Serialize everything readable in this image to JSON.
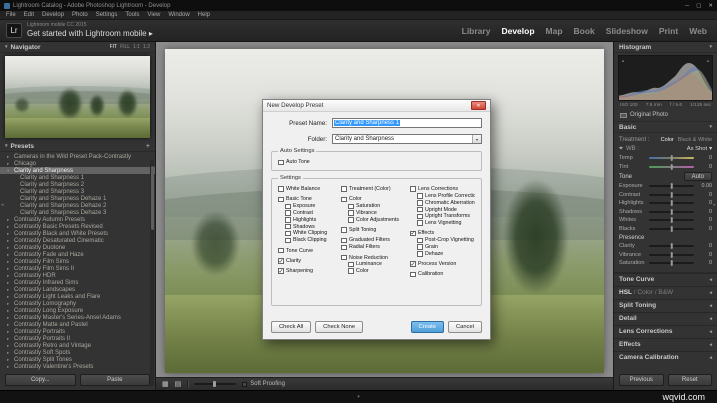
{
  "window": {
    "title": "Lightroom Catalog - Adobe Photoshop Lightroom - Develop"
  },
  "menubar": {
    "items": [
      "File",
      "Edit",
      "Develop",
      "Photo",
      "Settings",
      "Tools",
      "View",
      "Window",
      "Help"
    ]
  },
  "header": {
    "logo": "Lr",
    "identity_small": "Lightroom mobile CC 2015",
    "identity_large": "Get started with Lightroom mobile ▸",
    "modules": [
      {
        "label": "Library",
        "active": false
      },
      {
        "label": "Develop",
        "active": true
      },
      {
        "label": "Map",
        "active": false
      },
      {
        "label": "Book",
        "active": false
      },
      {
        "label": "Slideshow",
        "active": false
      },
      {
        "label": "Print",
        "active": false
      },
      {
        "label": "Web",
        "active": false
      }
    ]
  },
  "navigator": {
    "title": "Navigator",
    "zoom_options": [
      "FIT",
      "FILL",
      "1:1",
      "1:2"
    ]
  },
  "presets": {
    "title": "Presets",
    "add_label": "+",
    "items": [
      {
        "label": "Cameras in the Wild Preset Pack-Contrastly",
        "type": "folder"
      },
      {
        "label": "Chicago",
        "type": "folder"
      },
      {
        "label": "Clarity and Sharpness",
        "type": "folder",
        "expanded": true,
        "active": true
      },
      {
        "label": "Clarity and Sharpness 1",
        "type": "preset"
      },
      {
        "label": "Clarity and Sharpness 2",
        "type": "preset"
      },
      {
        "label": "Clarity and Sharpness 3",
        "type": "preset"
      },
      {
        "label": "Clarity and Sharpness Dehaze 1",
        "type": "preset"
      },
      {
        "label": "Clarity and Sharpness Dehaze 2",
        "type": "preset"
      },
      {
        "label": "Clarity and Sharpness Dehaze 3",
        "type": "preset"
      },
      {
        "label": "Contrastly Autumn Presets",
        "type": "folder"
      },
      {
        "label": "Contrastly Basic Presets Revised",
        "type": "folder"
      },
      {
        "label": "Contrastly Black and White Presets",
        "type": "folder"
      },
      {
        "label": "Contrastly Desaturated Cinematic",
        "type": "folder"
      },
      {
        "label": "Contrastly Duotone",
        "type": "folder"
      },
      {
        "label": "Contrastly Fade and Haze",
        "type": "folder"
      },
      {
        "label": "Contrastly Film Sims",
        "type": "folder"
      },
      {
        "label": "Contrastly Film Sims II",
        "type": "folder"
      },
      {
        "label": "Contrastly HDR",
        "type": "folder"
      },
      {
        "label": "Contrastly Infrared Sims",
        "type": "folder"
      },
      {
        "label": "Contrastly Landscapes",
        "type": "folder"
      },
      {
        "label": "Contrastly Light Leaks and Flare",
        "type": "folder"
      },
      {
        "label": "Contrastly Lomography",
        "type": "folder"
      },
      {
        "label": "Contrastly Long Exposure",
        "type": "folder"
      },
      {
        "label": "Contrastly Master's Series-Ansel Adams",
        "type": "folder"
      },
      {
        "label": "Contrastly Matte and Pastel",
        "type": "folder"
      },
      {
        "label": "Contrastly Portraits",
        "type": "folder"
      },
      {
        "label": "Contrastly Portraits II",
        "type": "folder"
      },
      {
        "label": "Contrastly Retro and Vintage",
        "type": "folder"
      },
      {
        "label": "Contrastly Soft Spots",
        "type": "folder"
      },
      {
        "label": "Contrastly Split Tones",
        "type": "folder"
      },
      {
        "label": "Contrastly Valentine's Presets",
        "type": "folder"
      }
    ]
  },
  "left_buttons": {
    "copy": "Copy...",
    "paste": "Paste"
  },
  "toolbar": {
    "soft_proofing": "Soft Proofing"
  },
  "dialog": {
    "title": "New Develop Preset",
    "preset_name_label": "Preset Name:",
    "preset_name_value": "Clarity and Sharpness 1",
    "folder_label": "Folder:",
    "folder_value": "Clarity and Sharpness",
    "auto_group_label": "Auto Settings",
    "auto_tone": {
      "label": "Auto Tone",
      "checked": false
    },
    "settings_group_label": "Settings",
    "columns": [
      [
        {
          "label": "White Balance",
          "checked": false
        },
        {
          "label": "Basic Tone",
          "checked": false,
          "gap": true
        },
        {
          "label": "Exposure",
          "checked": false,
          "sub": true
        },
        {
          "label": "Contrast",
          "checked": false,
          "sub": true
        },
        {
          "label": "Highlights",
          "checked": false,
          "sub": true
        },
        {
          "label": "Shadows",
          "checked": false,
          "sub": true
        },
        {
          "label": "White Clipping",
          "checked": false,
          "sub": true
        },
        {
          "label": "Black Clipping",
          "checked": false,
          "sub": true
        },
        {
          "label": "Tone Curve",
          "checked": false,
          "gap": true
        },
        {
          "label": "Clarity",
          "checked": true,
          "gap": true
        },
        {
          "label": "Sharpening",
          "checked": true,
          "gap": true
        }
      ],
      [
        {
          "label": "Treatment (Color)",
          "checked": false
        },
        {
          "label": "Color",
          "checked": false,
          "gap": true
        },
        {
          "label": "Saturation",
          "checked": false,
          "sub": true
        },
        {
          "label": "Vibrance",
          "checked": false,
          "sub": true
        },
        {
          "label": "Color Adjustments",
          "checked": false,
          "sub": true
        },
        {
          "label": "Split Toning",
          "checked": false,
          "gap": true
        },
        {
          "label": "Graduated Filters",
          "checked": false,
          "gap": true
        },
        {
          "label": "Radial Filters",
          "checked": false
        },
        {
          "label": "Noise Reduction",
          "checked": false,
          "gap": true
        },
        {
          "label": "Luminance",
          "checked": false,
          "sub": true
        },
        {
          "label": "Color",
          "checked": false,
          "sub": true
        }
      ],
      [
        {
          "label": "Lens Corrections",
          "checked": false
        },
        {
          "label": "Lens Profile Corrections",
          "checked": false,
          "sub": true
        },
        {
          "label": "Chromatic Aberration",
          "checked": false,
          "sub": true
        },
        {
          "label": "Upright Mode",
          "checked": false,
          "sub": true
        },
        {
          "label": "Upright Transforms",
          "checked": false,
          "sub": true
        },
        {
          "label": "Lens Vignetting",
          "checked": false,
          "sub": true
        },
        {
          "label": "Effects",
          "checked": true,
          "gap": true
        },
        {
          "label": "Post-Crop Vignetting",
          "checked": false,
          "sub": true
        },
        {
          "label": "Grain",
          "checked": false,
          "sub": true
        },
        {
          "label": "Dehaze",
          "checked": false,
          "sub": true
        },
        {
          "label": "Process Version",
          "checked": true,
          "gap": true
        },
        {
          "label": "Calibration",
          "checked": false,
          "gap": true
        }
      ]
    ],
    "buttons": {
      "check_all": "Check All",
      "check_none": "Check None",
      "create": "Create",
      "cancel": "Cancel"
    }
  },
  "right_panel": {
    "histogram": {
      "title": "Histogram",
      "exif_parts": [
        "ISO 100",
        "7.5 mm",
        "f / 5.6",
        "1/125 sec"
      ]
    },
    "original_photo": "Original Photo",
    "basic": {
      "title": "Basic",
      "treatment_label": "Treatment :",
      "treatment_options": [
        {
          "label": "Color",
          "active": true
        },
        {
          "label": "Black & White",
          "active": false
        }
      ],
      "wb_label": "WB :",
      "wb_value": "As Shot",
      "sliders_wb": [
        {
          "label": "Temp",
          "value": "0",
          "kind": "temp"
        },
        {
          "label": "Tint",
          "value": "0",
          "kind": "tint"
        }
      ],
      "tone_label": "Tone",
      "auto_button": "Auto",
      "sliders_tone": [
        {
          "label": "Exposure",
          "value": "0.00"
        },
        {
          "label": "Contrast",
          "value": "0"
        },
        {
          "label": "Highlights",
          "value": "0"
        },
        {
          "label": "Shadows",
          "value": "0"
        },
        {
          "label": "Whites",
          "value": "0"
        },
        {
          "label": "Blacks",
          "value": "0"
        }
      ],
      "presence_label": "Presence",
      "sliders_presence": [
        {
          "label": "Clarity",
          "value": "0"
        },
        {
          "label": "Vibrance",
          "value": "0"
        },
        {
          "label": "Saturation",
          "value": "0"
        }
      ]
    },
    "collapsed_panels": [
      "Tone Curve",
      "HSL / Color / B&W",
      "Split Toning",
      "Detail",
      "Lens Corrections",
      "Effects",
      "Camera Calibration"
    ],
    "previous_button": "Previous",
    "reset_button": "Reset"
  },
  "watermark": "wqvid.com",
  "icons": {
    "minimize": "─",
    "maximize": "▢",
    "close": "✕",
    "dialog_close": "✕",
    "triangle_down": "▾",
    "triangle_right": "▸",
    "triangle_left": "◂",
    "plus": "+",
    "eyedropper": "⌖",
    "grid_view": "▦",
    "loupe_view": "▤",
    "dropdown_arrow": "▾",
    "clip_triangle": "▲"
  },
  "colors": {
    "selection_blue": "#3399ff",
    "create_button_blue": "#4f9fd8",
    "module_active": "#ffffff"
  }
}
